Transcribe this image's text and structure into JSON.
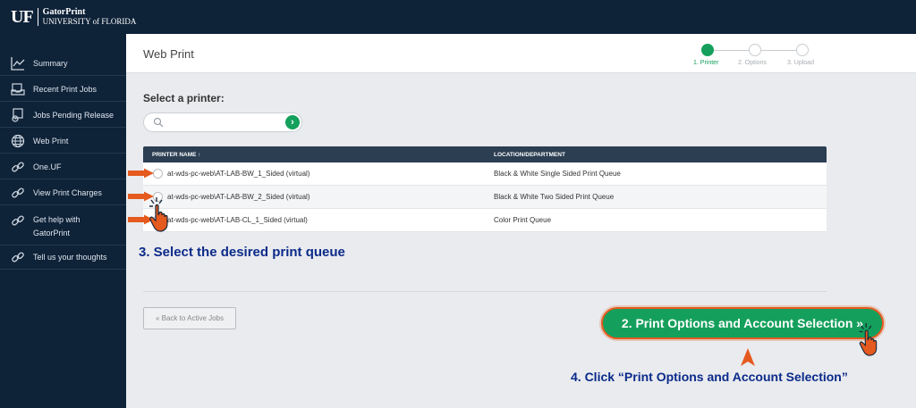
{
  "brand": {
    "logo_mark": "UF",
    "app_name": "GatorPrint",
    "university": "UNIVERSITY of FLORIDA"
  },
  "sidebar": {
    "items": [
      {
        "label": "Summary",
        "icon": "line-chart-icon"
      },
      {
        "label": "Recent Print Jobs",
        "icon": "inbox-icon"
      },
      {
        "label": "Jobs Pending Release",
        "icon": "print-release-icon"
      },
      {
        "label": "Web Print",
        "icon": "globe-icon"
      },
      {
        "label": "One.UF",
        "icon": "link-icon"
      },
      {
        "label": "View Print Charges",
        "icon": "link-icon"
      },
      {
        "label": "Get help with GatorPrint",
        "icon": "link-icon"
      },
      {
        "label": "Tell us your thoughts",
        "icon": "link-icon"
      }
    ]
  },
  "header": {
    "title": "Web Print",
    "steps": [
      {
        "label": "1. Printer",
        "active": true
      },
      {
        "label": "2. Options",
        "active": false
      },
      {
        "label": "3. Upload",
        "active": false
      }
    ]
  },
  "main": {
    "select_label": "Select a printer:",
    "search_placeholder": "",
    "search_go": "›",
    "table": {
      "col_printer": "PRINTER NAME ↑",
      "col_location": "LOCATION/DEPARTMENT",
      "rows": [
        {
          "name": "at-wds-pc-web\\AT-LAB-BW_1_Sided (virtual)",
          "location": "Black & White Single Sided Print Queue"
        },
        {
          "name": "at-wds-pc-web\\AT-LAB-BW_2_Sided (virtual)",
          "location": "Black & White Two Sided Print Queue"
        },
        {
          "name": "at-wds-pc-web\\AT-LAB-CL_1_Sided (virtual)",
          "location": "Color Print Queue"
        }
      ]
    },
    "back_button": "« Back to Active Jobs",
    "next_button": "2. Print Options and Account Selection »"
  },
  "annotations": {
    "step3": "3. Select the desired print queue",
    "step4": "4. Click “Print Options and Account Selection”"
  },
  "colors": {
    "navy": "#0e2238",
    "green": "#14a05c",
    "orange": "#e55a1f",
    "annotation_blue": "#0b2a8a"
  }
}
